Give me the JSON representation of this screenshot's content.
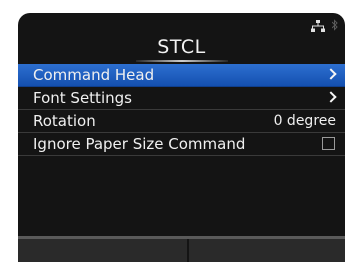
{
  "header": {
    "title": "STCL",
    "icons": [
      "network-icon",
      "bluetooth-icon"
    ]
  },
  "menu": {
    "items": [
      {
        "label": "Command Head",
        "type": "submenu",
        "selected": true
      },
      {
        "label": "Font Settings",
        "type": "submenu",
        "selected": false
      },
      {
        "label": "Rotation",
        "type": "value",
        "value": "0 degree",
        "selected": false
      },
      {
        "label": "Ignore Paper Size Command",
        "type": "checkbox",
        "checked": false,
        "selected": false
      }
    ]
  },
  "colors": {
    "background": "#141414",
    "selection": "#1f5fc4",
    "text": "#f0f0f0"
  }
}
